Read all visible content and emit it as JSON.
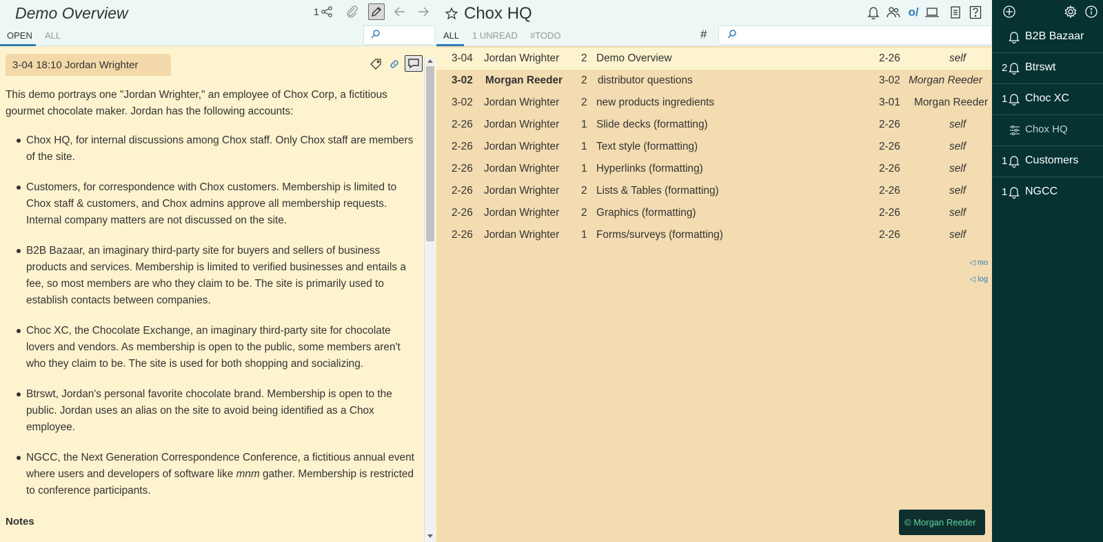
{
  "left_pane": {
    "title": "Demo Overview",
    "share_count": "1",
    "tabs": [
      "OPEN",
      "ALL"
    ],
    "message": {
      "header": "3-04 18:10 Jordan Wrighter",
      "intro": "This demo portrays one \"Jordan Wrighter,\" an employee of Chox Corp, a fictitious gourmet chocolate maker. Jordan has the following accounts:",
      "bullets": [
        "Chox HQ, for internal discussions among Chox staff. Only Chox staff are members of the site.",
        "Customers, for correspondence with Chox customers. Membership is limited to Chox staff & customers, and Chox admins approve all membership requests. Internal company matters are not discussed on the site.",
        "B2B Bazaar, an imaginary third-party site for buyers and sellers of business products and services. Membership is limited to verified businesses and entails a fee, so most members are who they claim to be. The site is primarily used to establish contacts between companies.",
        "Choc XC, the Chocolate Exchange, an imaginary third-party site for chocolate lovers and vendors. As membership is open to the public, some members aren't who they claim to be. The site is used for both shopping and socializing.",
        "Btrswt, Jordan's personal favorite chocolate brand. Membership is open to the public. Jordan uses an alias on the site to avoid being identified as a Chox employee."
      ],
      "ngcc_bullet": {
        "before": "NGCC, the Next Generation Correspondence Conference, a fictitious annual event where users and developers of software like ",
        "emph": "mnm",
        "after": " gather. Membership is restricted to conference participants."
      },
      "notes_heading": "Notes"
    }
  },
  "middle_pane": {
    "title": "Chox HQ",
    "o_slash": "o/",
    "tabs": [
      "ALL",
      "1 UNREAD",
      "#TODO"
    ],
    "hash_label": "#",
    "rows": [
      {
        "date": "3-04",
        "author": "Jordan Wrighter",
        "count": "2",
        "subject": "Demo Overview",
        "last": "2-26",
        "by": "self"
      },
      {
        "date": "3-02",
        "author": "Morgan Reeder",
        "count": "2",
        "subject": "distributor questions",
        "last": "3-02",
        "by": "Morgan Reeder"
      },
      {
        "date": "3-02",
        "author": "Jordan Wrighter",
        "count": "2",
        "subject": "new products ingredients",
        "last": "3-01",
        "by": "Morgan Reeder"
      },
      {
        "date": "2-26",
        "author": "Jordan Wrighter",
        "count": "1",
        "subject": "Slide decks (formatting)",
        "last": "2-26",
        "by": "self"
      },
      {
        "date": "2-26",
        "author": "Jordan Wrighter",
        "count": "1",
        "subject": "Text style (formatting)",
        "last": "2-26",
        "by": "self"
      },
      {
        "date": "2-26",
        "author": "Jordan Wrighter",
        "count": "1",
        "subject": "Hyperlinks (formatting)",
        "last": "2-26",
        "by": "self"
      },
      {
        "date": "2-26",
        "author": "Jordan Wrighter",
        "count": "2",
        "subject": "Lists & Tables (formatting)",
        "last": "2-26",
        "by": "self"
      },
      {
        "date": "2-26",
        "author": "Jordan Wrighter",
        "count": "2",
        "subject": "Graphics (formatting)",
        "last": "2-26",
        "by": "self"
      },
      {
        "date": "2-26",
        "author": "Jordan Wrighter",
        "count": "1",
        "subject": "Forms/surveys (formatting)",
        "last": "2-26",
        "by": "self"
      }
    ],
    "more_link": "◁ mo",
    "log_link": "◁ log",
    "toast": "© Morgan Reeder"
  },
  "sidebar": {
    "sites": [
      {
        "count": "",
        "name": "B2B Bazaar"
      },
      {
        "count": "2",
        "name": "Btrswt"
      },
      {
        "count": "1",
        "name": "Choc XC"
      },
      {
        "count": "",
        "name": "Chox HQ"
      },
      {
        "count": "1",
        "name": "Customers"
      },
      {
        "count": "1",
        "name": "NGCC"
      }
    ]
  },
  "colors": {
    "accent": "#2b7bb9",
    "left_bg": "#fdf3cf",
    "mid_bg": "#f3dcb1",
    "header_bg": "#ecf7f6",
    "sidebar_bg": "#063232",
    "toast_text": "#5fd4a0"
  },
  "icons": [
    "share-icon",
    "attach-icon",
    "edit-icon",
    "back-arrow-icon",
    "forward-arrow-icon",
    "search-icon",
    "tag-icon",
    "link-icon",
    "reply-icon",
    "star-icon",
    "bell-icon",
    "people-icon",
    "laptop-icon",
    "document-icon",
    "help-icon",
    "plus-circle-icon",
    "gear-icon",
    "info-icon",
    "sliders-icon"
  ]
}
